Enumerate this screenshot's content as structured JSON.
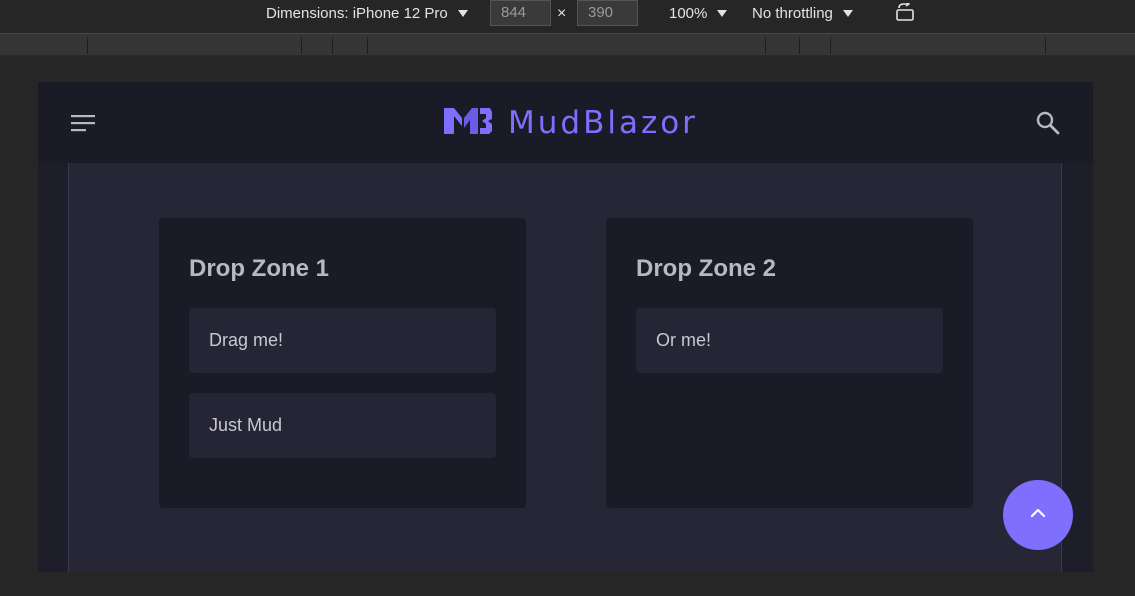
{
  "devtools": {
    "dimensions_label": "Dimensions: iPhone 12 Pro",
    "width_value": "844",
    "height_value": "390",
    "times": "×",
    "zoom": "100%",
    "throttling": "No throttling"
  },
  "appbar": {
    "brand_name": "MudBlazor",
    "brand_color": "#7e6fff"
  },
  "zones": [
    {
      "title": "Drop Zone 1",
      "items": [
        "Drag me!",
        "Just Mud"
      ]
    },
    {
      "title": "Drop Zone 2",
      "items": [
        "Or me!"
      ]
    }
  ],
  "icons": {
    "menu": "menu-icon",
    "search": "search-icon",
    "fab": "chevron-up-icon",
    "rotate": "rotate-icon"
  },
  "colors": {
    "accent": "#7e6fff",
    "surface": "#1b1b27",
    "background": "#272636"
  }
}
